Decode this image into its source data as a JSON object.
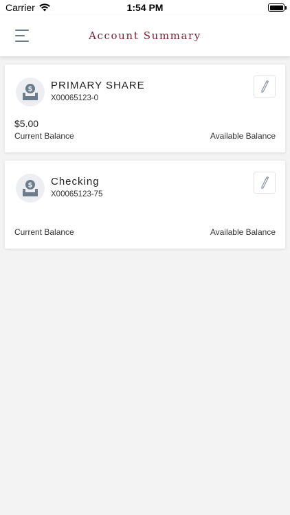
{
  "status_bar": {
    "carrier": "Carrier",
    "time": "1:54 PM"
  },
  "header": {
    "title": "Account Summary"
  },
  "accounts": [
    {
      "name": "PRIMARY SHARE",
      "number": "X00065123-0",
      "current_balance": "$5.00",
      "current_balance_label": "Current Balance",
      "available_balance_label": "Available Balance"
    },
    {
      "name": "Checking",
      "number": "X00065123-75",
      "current_balance": "",
      "current_balance_label": "Current Balance",
      "available_balance_label": "Available Balance"
    }
  ],
  "icons": {
    "menu": "hamburger-menu-icon",
    "account": "money-deposit-icon",
    "edit": "pencil-icon",
    "wifi": "wifi-icon",
    "battery": "battery-icon"
  },
  "colors": {
    "title": "#7a1f2e",
    "icon_gray": "#6b7c8c",
    "background": "#f3f3f3"
  }
}
